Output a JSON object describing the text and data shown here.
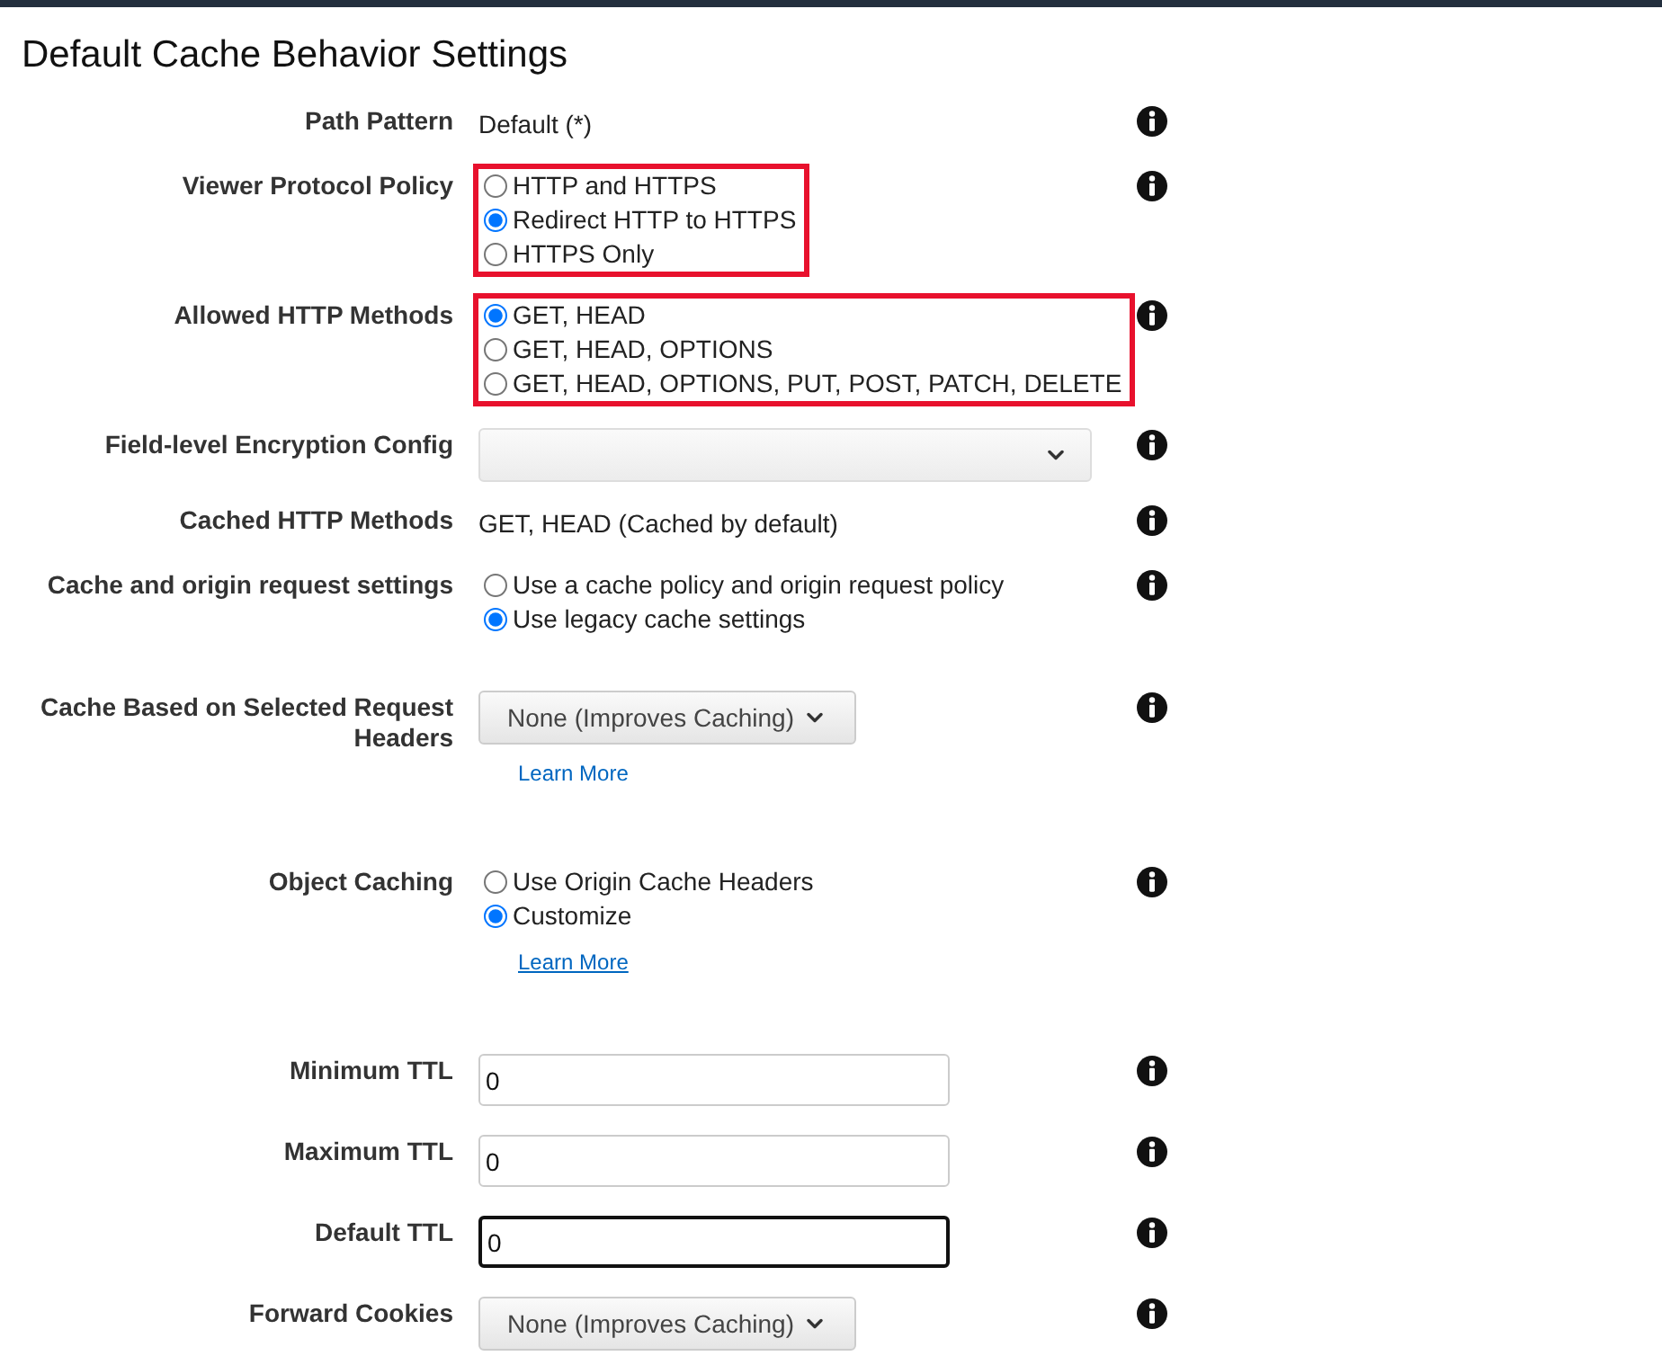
{
  "title": "Default Cache Behavior Settings",
  "rows": [
    {
      "label": "Path Pattern",
      "kind": "text",
      "value": "Default (*)"
    },
    {
      "label": "Viewer Protocol Policy",
      "kind": "radio",
      "highlighted": true,
      "options": [
        {
          "label": "HTTP and HTTPS",
          "selected": false
        },
        {
          "label": "Redirect HTTP to HTTPS",
          "selected": true
        },
        {
          "label": "HTTPS Only",
          "selected": false
        }
      ]
    },
    {
      "label": "Allowed HTTP Methods",
      "kind": "radio",
      "highlighted": true,
      "options": [
        {
          "label": "GET, HEAD",
          "selected": true
        },
        {
          "label": "GET, HEAD, OPTIONS",
          "selected": false
        },
        {
          "label": "GET, HEAD, OPTIONS, PUT, POST, PATCH, DELETE",
          "selected": false
        }
      ]
    },
    {
      "label": "Field-level Encryption Config",
      "kind": "select"
    },
    {
      "label": "Cached HTTP Methods",
      "kind": "text",
      "value": "GET, HEAD (Cached by default)"
    },
    {
      "label": "Cache and origin request settings",
      "kind": "radio",
      "highlighted": false,
      "options": [
        {
          "label": "Use a cache policy and origin request policy",
          "selected": false
        },
        {
          "label": "Use legacy cache settings",
          "selected": true
        }
      ]
    },
    {
      "label": "Cache Based on Selected Request Headers",
      "kind": "dropdown",
      "value": "None (Improves Caching)",
      "link": {
        "text": "Learn More",
        "underlined": false
      }
    },
    {
      "label": "Object Caching",
      "kind": "radio",
      "highlighted": false,
      "options": [
        {
          "label": "Use Origin Cache Headers",
          "selected": false
        },
        {
          "label": "Customize",
          "selected": true
        }
      ],
      "link": {
        "text": "Learn More",
        "underlined": true
      }
    },
    {
      "label": "Minimum TTL",
      "kind": "input",
      "value": "0",
      "focused": false
    },
    {
      "label": "Maximum TTL",
      "kind": "input",
      "value": "0",
      "focused": false
    },
    {
      "label": "Default TTL",
      "kind": "input",
      "value": "0",
      "focused": true
    },
    {
      "label": "Forward Cookies",
      "kind": "dropdown",
      "value": "None (Improves Caching)"
    }
  ]
}
